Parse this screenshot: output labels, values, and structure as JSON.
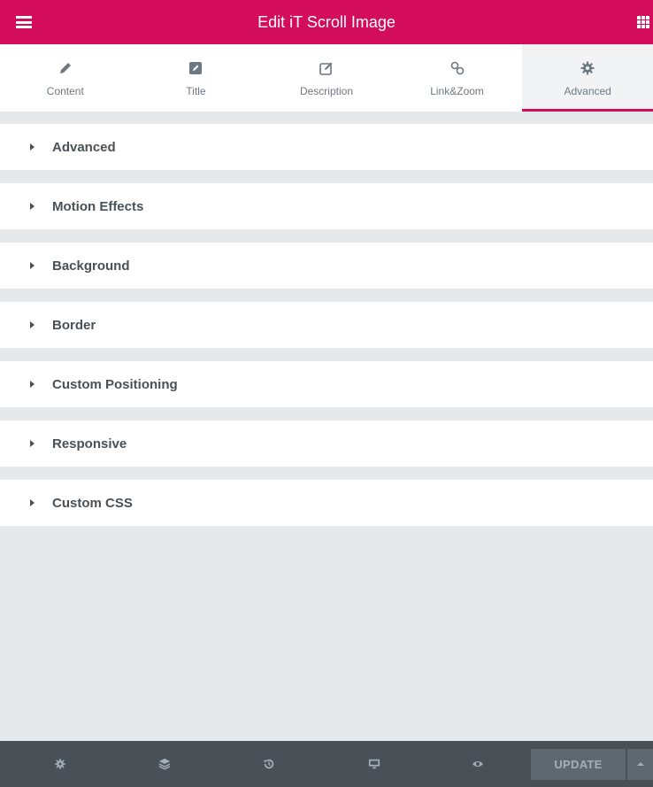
{
  "header": {
    "title": "Edit iT Scroll Image",
    "bg_color": "#d30c5c",
    "menu_icon": "hamburger-icon",
    "apps_icon": "apps-grid-icon"
  },
  "tabs": [
    {
      "label": "Content",
      "icon": "pencil-icon",
      "active": false
    },
    {
      "label": "Title",
      "icon": "edit-square-icon",
      "active": false
    },
    {
      "label": "Description",
      "icon": "edit-outline-icon",
      "active": false
    },
    {
      "label": "Link&Zoom",
      "icon": "link-icon",
      "active": false
    },
    {
      "label": "Advanced",
      "icon": "gear-icon",
      "active": true
    }
  ],
  "sections": [
    {
      "label": "Advanced"
    },
    {
      "label": "Motion Effects"
    },
    {
      "label": "Background"
    },
    {
      "label": "Border"
    },
    {
      "label": "Custom Positioning"
    },
    {
      "label": "Responsive"
    },
    {
      "label": "Custom CSS"
    }
  ],
  "footer": {
    "icons": [
      "settings-icon",
      "navigator-layers-icon",
      "history-icon",
      "responsive-desktop-icon",
      "preview-eye-icon"
    ],
    "update_label": "UPDATE",
    "more_icon": "caret-up-icon"
  }
}
